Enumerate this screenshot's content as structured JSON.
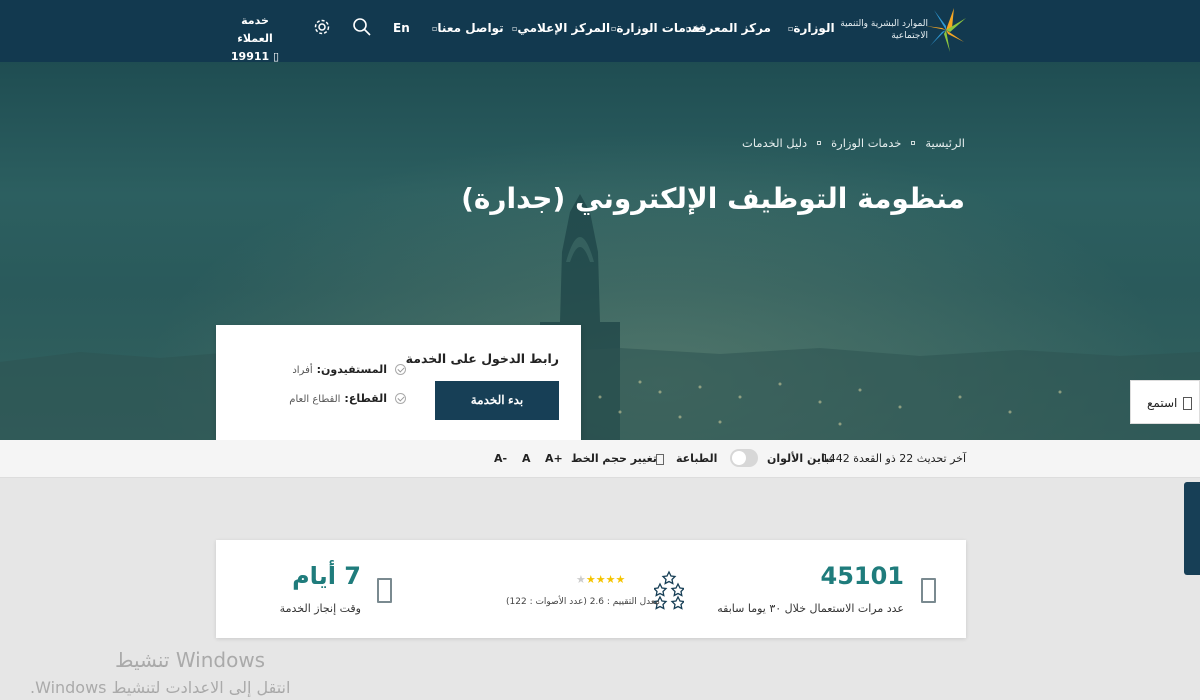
{
  "navbar": {
    "logo_text": "الموارد البشرية والتنمية الاجتماعية",
    "items": [
      {
        "label": "الوزارة"
      },
      {
        "label": "مركز المعرفة"
      },
      {
        "label": "خدمات الوزارة"
      },
      {
        "label": "المركز الإعلامي"
      },
      {
        "label": "تواصل معنا"
      }
    ],
    "lang": "En",
    "customer_service_label": "خدمة العملاء",
    "customer_service_number": "19911"
  },
  "hero": {
    "breadcrumb": [
      "الرئيسية",
      "خدمات الوزارة",
      "دليل الخدمات"
    ],
    "title": "منظومة التوظيف الإلكتروني (جدارة)"
  },
  "service_card": {
    "heading": "رابط الدخول على الخدمة",
    "button": "بدء الخدمة",
    "beneficiaries_label": "المستفيدون:",
    "beneficiaries_value": "أفراد",
    "sector_label": "القطاع:",
    "sector_value": "القطاع العام"
  },
  "listen_label": "استمع",
  "toolbar": {
    "last_update": "آخر تحديث 22 ذو القعدة 1442",
    "contrast_label": "تباين الألوان",
    "print_label": "الطباعة",
    "font_size_label": "تغيير حجم الخط",
    "font_increase": "A+",
    "font_normal": "A",
    "font_decrease": "A-"
  },
  "stats": {
    "usage_count": "45101",
    "usage_caption": "عدد مرات الاستعمال خلال ٣٠ يوما سابقه",
    "rating_caption": "معدل التقييم : 2.6 (عدد الأصوات : 122)",
    "rating_value": 2.6,
    "rating_max": 5,
    "completion_time": "7 أيام",
    "completion_caption": "وقت إنجاز الخدمة"
  },
  "watermark": {
    "line1": "تنشيط Windows",
    "line2": "انتقل إلى الاعدادت لتنشيط Windows."
  },
  "colors": {
    "navbar": "#12394f",
    "button": "#173f56",
    "accent": "#1f7c7c",
    "star": "#f5c400"
  }
}
